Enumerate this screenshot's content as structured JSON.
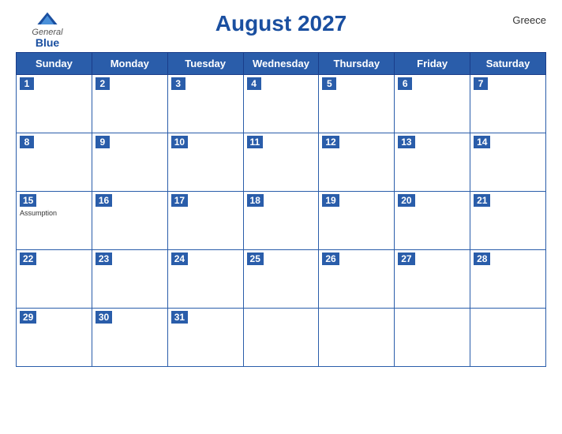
{
  "header": {
    "logo_general": "General",
    "logo_blue": "Blue",
    "title": "August 2027",
    "country": "Greece"
  },
  "days": [
    "Sunday",
    "Monday",
    "Tuesday",
    "Wednesday",
    "Thursday",
    "Friday",
    "Saturday"
  ],
  "weeks": [
    [
      {
        "date": "1",
        "holiday": ""
      },
      {
        "date": "2",
        "holiday": ""
      },
      {
        "date": "3",
        "holiday": ""
      },
      {
        "date": "4",
        "holiday": ""
      },
      {
        "date": "5",
        "holiday": ""
      },
      {
        "date": "6",
        "holiday": ""
      },
      {
        "date": "7",
        "holiday": ""
      }
    ],
    [
      {
        "date": "8",
        "holiday": ""
      },
      {
        "date": "9",
        "holiday": ""
      },
      {
        "date": "10",
        "holiday": ""
      },
      {
        "date": "11",
        "holiday": ""
      },
      {
        "date": "12",
        "holiday": ""
      },
      {
        "date": "13",
        "holiday": ""
      },
      {
        "date": "14",
        "holiday": ""
      }
    ],
    [
      {
        "date": "15",
        "holiday": "Assumption"
      },
      {
        "date": "16",
        "holiday": ""
      },
      {
        "date": "17",
        "holiday": ""
      },
      {
        "date": "18",
        "holiday": ""
      },
      {
        "date": "19",
        "holiday": ""
      },
      {
        "date": "20",
        "holiday": ""
      },
      {
        "date": "21",
        "holiday": ""
      }
    ],
    [
      {
        "date": "22",
        "holiday": ""
      },
      {
        "date": "23",
        "holiday": ""
      },
      {
        "date": "24",
        "holiday": ""
      },
      {
        "date": "25",
        "holiday": ""
      },
      {
        "date": "26",
        "holiday": ""
      },
      {
        "date": "27",
        "holiday": ""
      },
      {
        "date": "28",
        "holiday": ""
      }
    ],
    [
      {
        "date": "29",
        "holiday": ""
      },
      {
        "date": "30",
        "holiday": ""
      },
      {
        "date": "31",
        "holiday": ""
      },
      {
        "date": "",
        "holiday": ""
      },
      {
        "date": "",
        "holiday": ""
      },
      {
        "date": "",
        "holiday": ""
      },
      {
        "date": "",
        "holiday": ""
      }
    ]
  ]
}
